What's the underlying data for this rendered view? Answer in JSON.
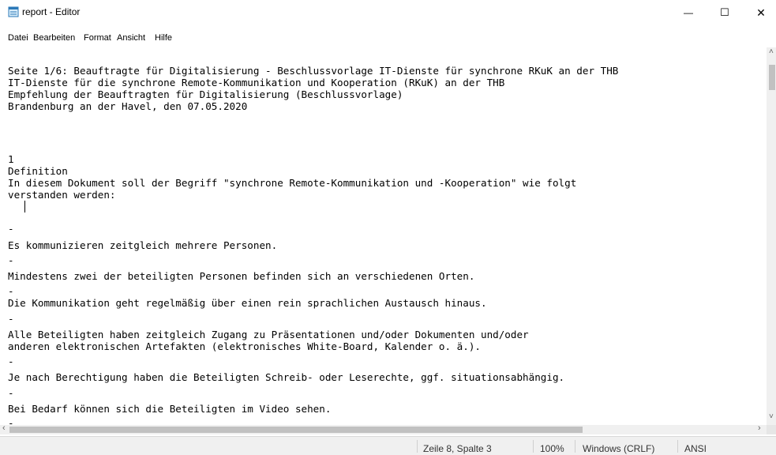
{
  "window": {
    "title": "report - Editor",
    "minimize": "—",
    "maximize": "☐",
    "close": "✕",
    "icon": "notepad-icon"
  },
  "menu": [
    "Datei",
    "Bearbeiten",
    "Format",
    "Ansicht",
    "Hilfe"
  ],
  "document": {
    "lines": [
      "Seite 1/6: Beauftragte für Digitalisierung - Beschlussvorlage IT-Dienste für synchrone RKuK an der THB",
      "IT-Dienste für die synchrone Remote-Kommunikation und Kooperation (RKuK) an der THB",
      "Empfehlung der Beauftragten für Digitalisierung (Beschlussvorlage)",
      "Brandenburg an der Havel, den 07.05.2020",
      "",
      "",
      "",
      "1",
      "Definition",
      "In diesem Dokument soll der Begriff \"synchrone Remote-Kommunikation und -Kooperation\" wie folgt",
      "verstanden werden:",
      "",
      "",
      "-",
      "Es kommunizieren zeitgleich mehrere Personen.",
      "-",
      "Mindestens zwei der beteiligten Personen befinden sich an verschiedenen Orten.",
      "-",
      "Die Kommunikation geht regelmäßig über einen rein sprachlichen Austausch hinaus.",
      "-",
      "Alle Beteiligten haben zeitgleich Zugang zu Präsentationen und/oder Dokumenten und/oder",
      "anderen elektronischen Artefakten (elektronisches White-Board, Kalender o. ä.).",
      "-",
      "Je nach Berechtigung haben die Beteiligten Schreib- oder Leserechte, ggf. situationsabhängig.",
      "-",
      "Bei Bedarf können sich die Beteiligten im Video sehen.",
      "-"
    ]
  },
  "scrollbars": {
    "up": "˄",
    "down": "˅",
    "left": "‹",
    "right": "›"
  },
  "status": {
    "position": "Zeile 8, Spalte 3",
    "zoom": "100%",
    "line_ending": "Windows (CRLF)",
    "encoding": "ANSI"
  }
}
